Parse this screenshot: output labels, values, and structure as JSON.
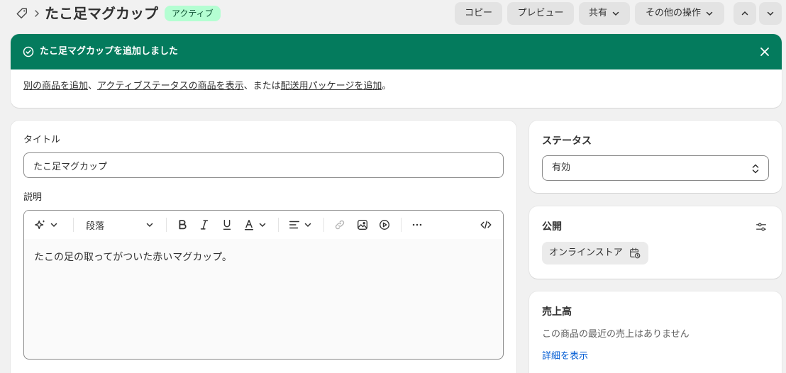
{
  "header": {
    "title": "たこ足マグカップ",
    "status_badge": "アクティブ",
    "buttons": {
      "copy": "コピー",
      "preview": "プレビュー",
      "share": "共有",
      "more_actions": "その他の操作"
    }
  },
  "banner": {
    "title": "たこ足マグカップを追加しました",
    "link_add_product": "別の商品を追加",
    "sep1": "、",
    "link_show_active": "アクティブステータスの商品を表示",
    "sep2": "、または",
    "link_add_package": "配送用パッケージを追加",
    "end": "。"
  },
  "product": {
    "title_label": "タイトル",
    "title_value": "たこ足マグカップ",
    "description_label": "説明",
    "toolbar": {
      "paragraph": "段落"
    },
    "description_text": "たこの足の取ってがついた赤いマグカップ。"
  },
  "status_card": {
    "title": "ステータス",
    "value": "有効"
  },
  "publishing_card": {
    "title": "公開",
    "channel": "オンラインストア"
  },
  "sales_card": {
    "title": "売上高",
    "empty_text": "この商品の最近の売上はありません",
    "link": "詳細を表示"
  },
  "colors": {
    "banner_green": "#047b5d",
    "badge_bg": "#b4fed2",
    "link_blue": "#005bd3"
  }
}
